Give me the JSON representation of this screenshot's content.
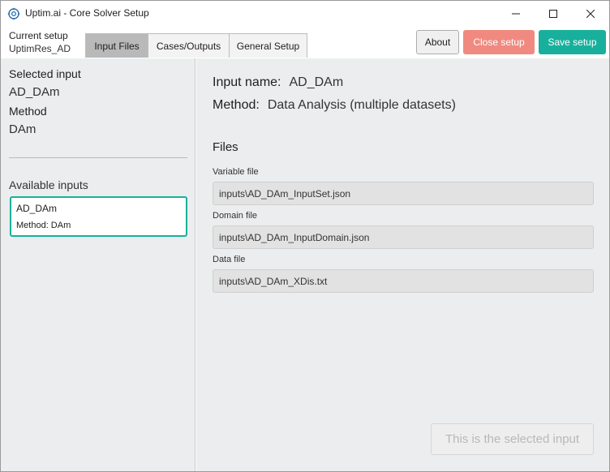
{
  "window": {
    "title": "Uptim.ai - Core Solver Setup"
  },
  "toolbar": {
    "current_setup_label": "Current setup",
    "current_setup_value": "UptimRes_AD",
    "tabs": [
      {
        "label": "Input Files",
        "active": true
      },
      {
        "label": "Cases/Outputs",
        "active": false
      },
      {
        "label": "General Setup",
        "active": false
      }
    ],
    "about_label": "About",
    "close_label": "Close setup",
    "save_label": "Save setup"
  },
  "sidebar": {
    "selected_input_label": "Selected input",
    "selected_input_value": "AD_DAm",
    "method_label": "Method",
    "method_value": "DAm",
    "available_inputs_label": "Available inputs",
    "inputs": [
      {
        "name": "AD_DAm",
        "method": "Method: DAm"
      }
    ]
  },
  "main": {
    "input_name_label": "Input name:",
    "input_name_value": "AD_DAm",
    "method_label": "Method:",
    "method_value": "Data Analysis (multiple datasets)",
    "files_title": "Files",
    "variable_file_label": "Variable file",
    "variable_file_value": "inputs\\AD_DAm_InputSet.json",
    "domain_file_label": "Domain file",
    "domain_file_value": "inputs\\AD_DAm_InputDomain.json",
    "data_file_label": "Data file",
    "data_file_value": "inputs\\AD_DAm_XDis.txt",
    "selected_button_label": "This is the selected input"
  },
  "icons": {
    "app": "gear-atom-icon",
    "minimize": "minimize-icon",
    "maximize": "maximize-icon",
    "close": "close-icon"
  },
  "colors": {
    "accent": "#18b09c",
    "close_button": "#f08a80",
    "active_tab": "#b9b9b9",
    "panel_bg": "#ecedee"
  }
}
